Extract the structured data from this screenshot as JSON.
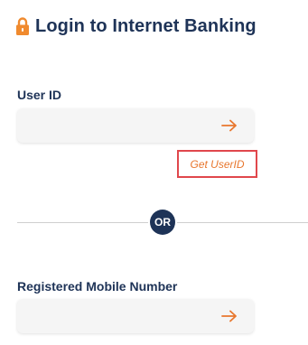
{
  "header": {
    "title": "Login to Internet Banking",
    "lock_icon": "lock-icon",
    "lock_color": "#f08a2e"
  },
  "user_id": {
    "label": "User ID",
    "value": "",
    "placeholder": "",
    "submit_icon": "arrow-right-icon"
  },
  "get_userid": {
    "label": "Get UserID"
  },
  "divider": {
    "label": "OR"
  },
  "mobile": {
    "label": "Registered Mobile Number",
    "value": "",
    "placeholder": "",
    "submit_icon": "arrow-right-icon"
  },
  "colors": {
    "primary": "#1e3357",
    "accent": "#e8772e",
    "highlight_border": "#e0474c",
    "input_bg": "#f5f5f5"
  }
}
